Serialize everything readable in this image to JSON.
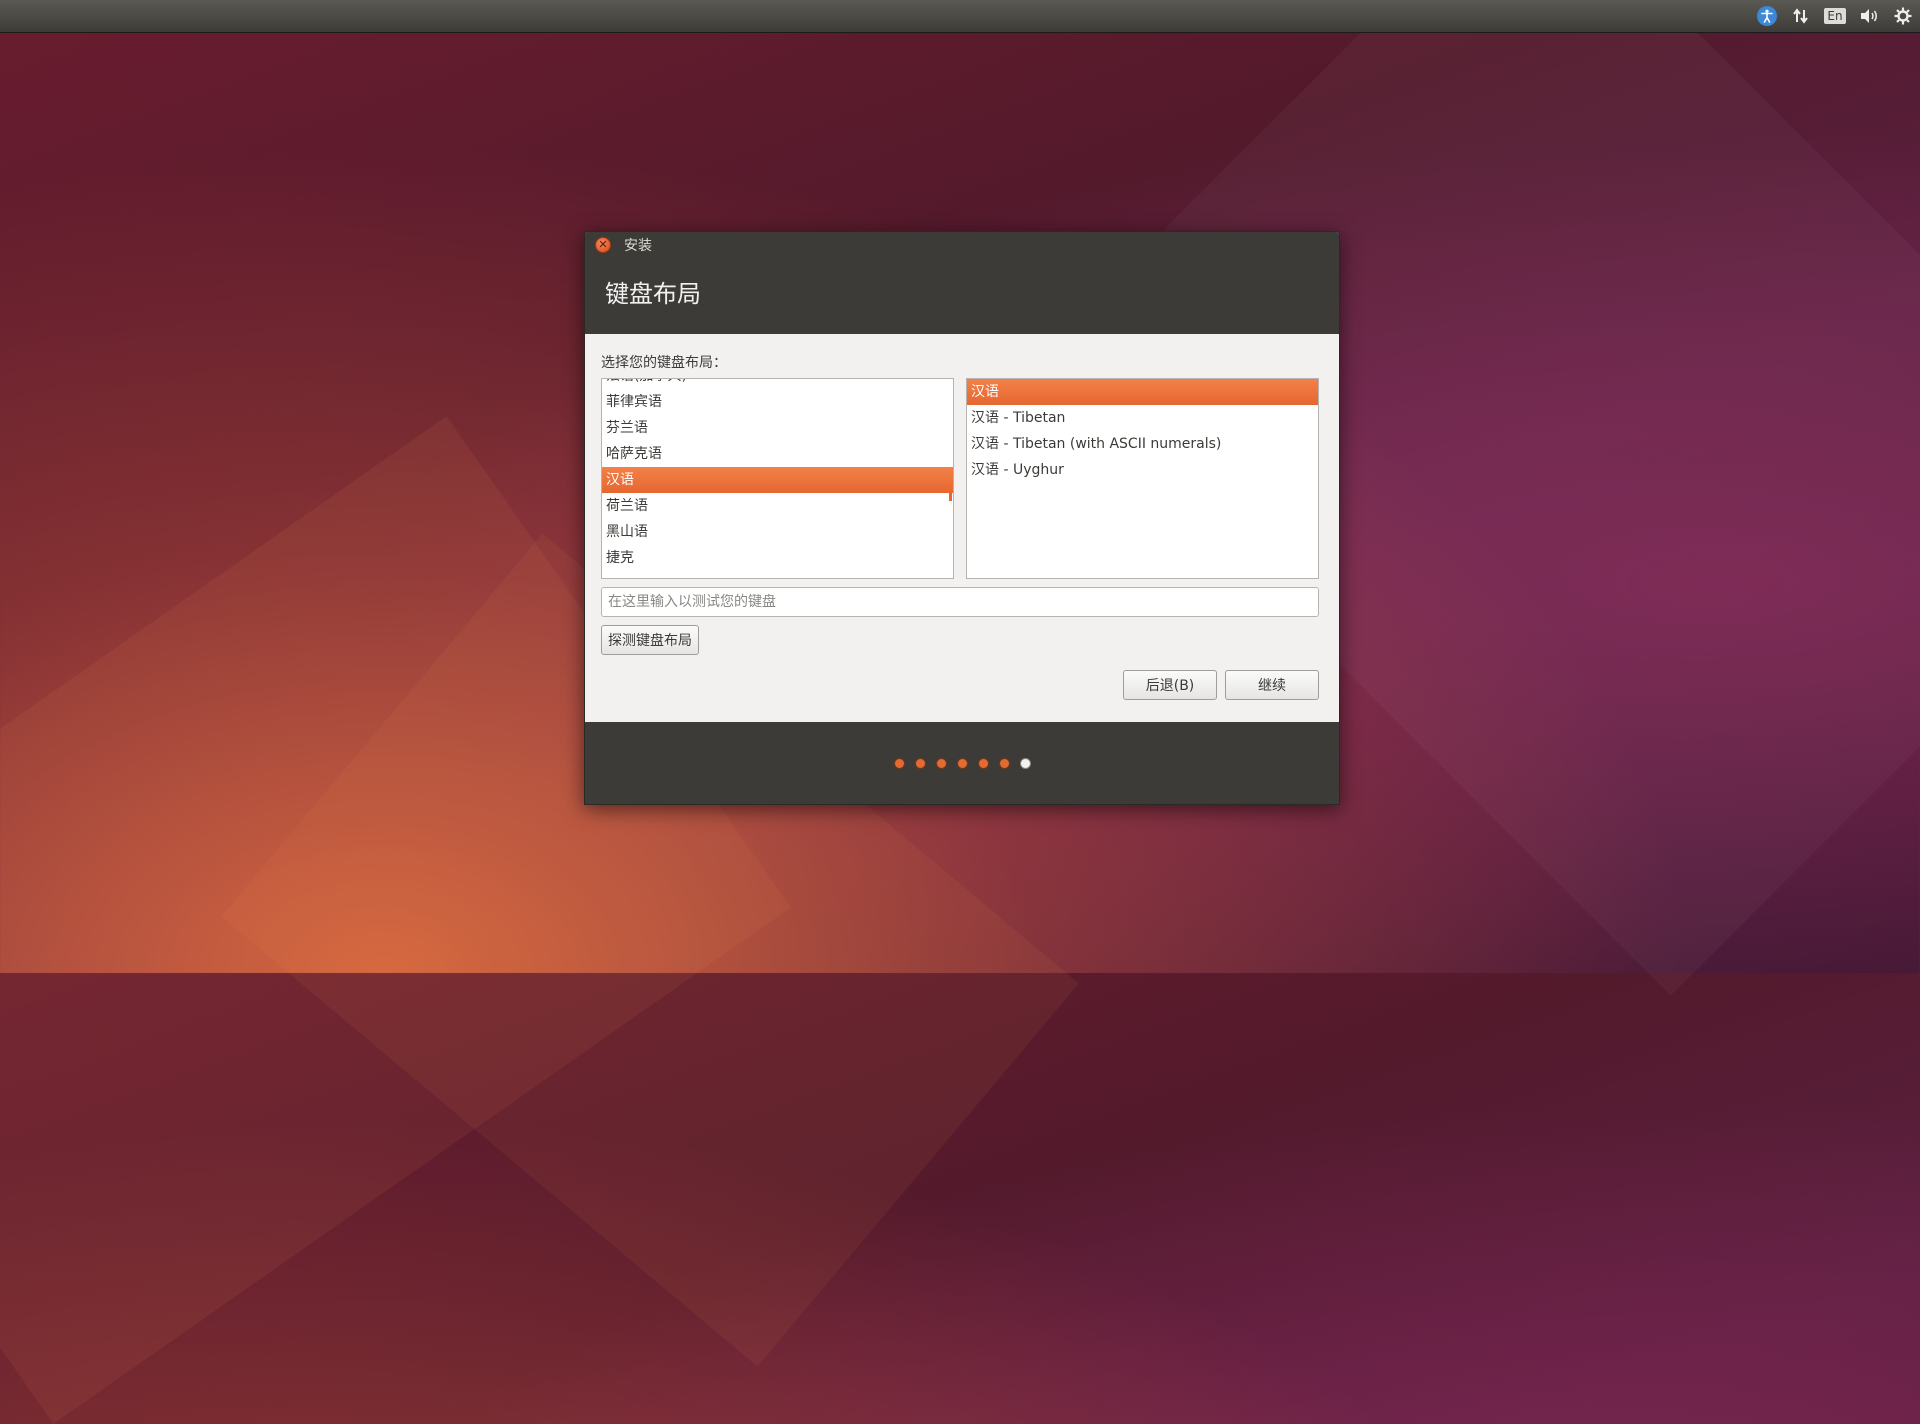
{
  "panel": {
    "input_method": "En"
  },
  "dialog": {
    "window_title": "安装",
    "page_title": "键盘布局",
    "prompt": "选择您的键盘布局：",
    "layouts": [
      {
        "label": "法语(加拿大)",
        "selected": false
      },
      {
        "label": "菲律宾语",
        "selected": false
      },
      {
        "label": "芬兰语",
        "selected": false
      },
      {
        "label": "哈萨克语",
        "selected": false
      },
      {
        "label": "汉语",
        "selected": true
      },
      {
        "label": "荷兰语",
        "selected": false
      },
      {
        "label": "黑山语",
        "selected": false
      },
      {
        "label": "捷克",
        "selected": false
      }
    ],
    "variants": [
      {
        "label": "汉语",
        "selected": true
      },
      {
        "label": "汉语 - Tibetan",
        "selected": false
      },
      {
        "label": "汉语 - Tibetan (with ASCII numerals)",
        "selected": false
      },
      {
        "label": "汉语 - Uyghur",
        "selected": false
      }
    ],
    "test_placeholder": "在这里输入以测试您的键盘",
    "detect_button": "探测键盘布局",
    "back_button": "后退(B)",
    "continue_button": "继续",
    "progress": {
      "total_steps": 7,
      "current_step": 7
    }
  },
  "colors": {
    "accent": "#e6662f",
    "header_bg": "#3c3b37",
    "dialog_bg": "#f2f1f0"
  }
}
